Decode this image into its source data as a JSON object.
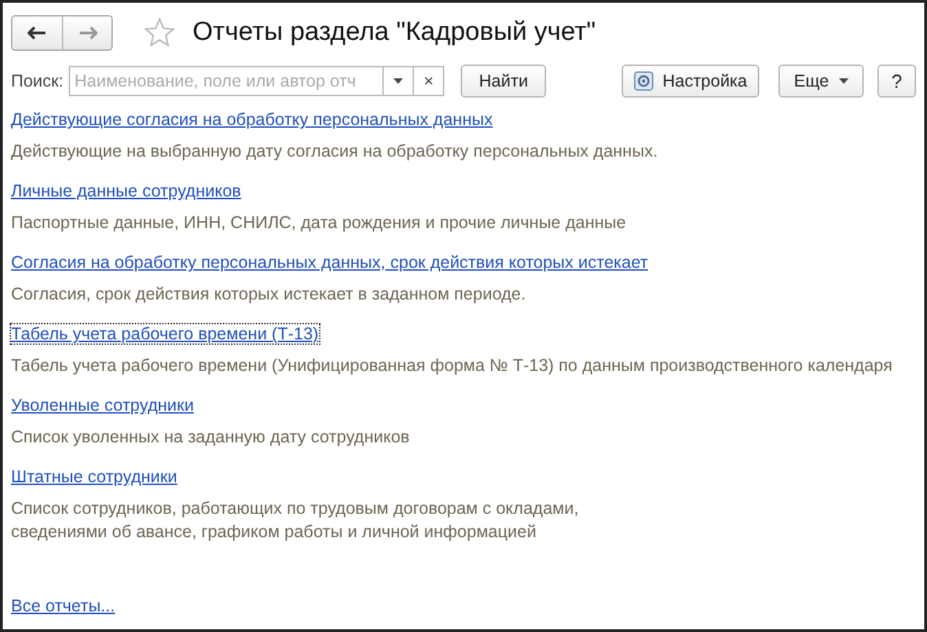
{
  "window": {
    "title": "Отчеты раздела \"Кадровый учет\"",
    "favorite": false
  },
  "search": {
    "label": "Поиск:",
    "placeholder": "Наименование, поле или автор отч",
    "clear": "×",
    "find_button": "Найти"
  },
  "toolbar": {
    "settings_button": "Настройка",
    "more_button": "Еще",
    "help_button": "?"
  },
  "reports": [
    {
      "title": "Действующие согласия на обработку персональных данных",
      "description": "Действующие на выбранную дату согласия на обработку персональных данных.",
      "focused": false
    },
    {
      "title": "Личные данные сотрудников",
      "description": "Паспортные данные, ИНН, СНИЛС, дата рождения и прочие личные данные",
      "focused": false
    },
    {
      "title": "Согласия на обработку персональных данных, срок действия которых истекает",
      "description": "Согласия, срок действия которых истекает в заданном периоде.",
      "focused": false
    },
    {
      "title": "Табель учета рабочего времени (Т-13)",
      "description": "Табель учета рабочего времени (Унифицированная форма № Т-13) по данным производственного календаря",
      "focused": true
    },
    {
      "title": "Уволенные сотрудники",
      "description": "Список уволенных на заданную дату сотрудников",
      "focused": false
    },
    {
      "title": "Штатные сотрудники",
      "description": "Список сотрудников, работающих по трудовым договорам с окладами,\nсведениями об авансе, графиком работы и личной информацией",
      "focused": false
    }
  ],
  "all_reports_link": "Все отчеты..."
}
